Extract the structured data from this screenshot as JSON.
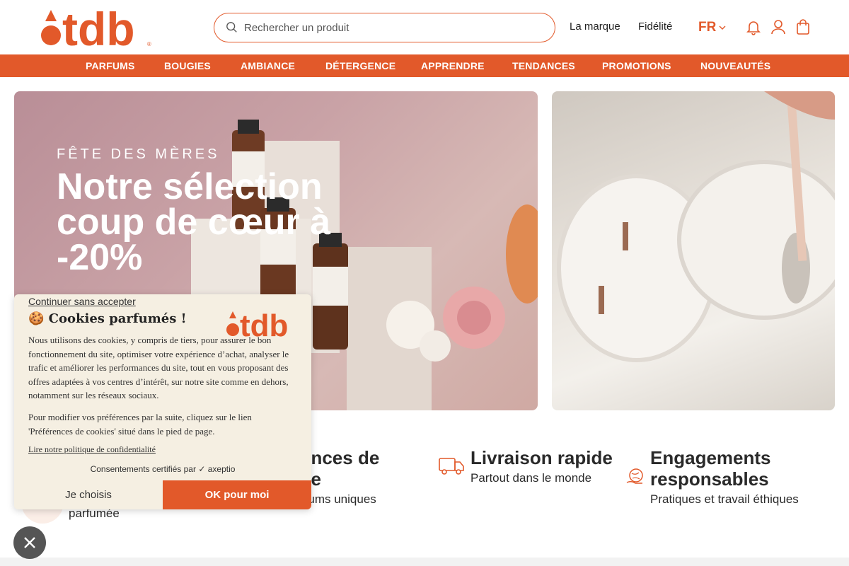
{
  "brand": {
    "name": "itdb",
    "accent": "#e2592a"
  },
  "header": {
    "search_placeholder": "Rechercher un produit",
    "links": [
      "La marque",
      "Fidélité"
    ],
    "lang": "FR",
    "icons": [
      "bell-icon",
      "user-icon",
      "bag-icon"
    ]
  },
  "nav": [
    "PARFUMS",
    "BOUGIES",
    "AMBIANCE",
    "DÉTERGENCE",
    "APPRENDRE",
    "TENDANCES",
    "PROMOTIONS",
    "NOUVEAUTÉS"
  ],
  "hero": {
    "eyebrow": "FÊTE DES MÈRES",
    "title": "Notre sélection coup de cœur à -20%"
  },
  "features": [
    {
      "title": "ances de",
      "title2": "se",
      "sub": "rfums uniques"
    },
    {
      "title": "Livraison rapide",
      "sub": "Partout dans le monde"
    },
    {
      "title": "Engagements",
      "title2": "responsables",
      "sub": "Pratiques et travail éthiques"
    }
  ],
  "peek_text": "parfumée",
  "cookie": {
    "continue": "Continuer sans accepter",
    "title": "🍪 Cookies parfumés !",
    "p1": "Nous utilisons des cookies, y compris de tiers, pour assurer le bon fonctionnement du site, optimiser votre expérience d’achat, analyser le trafic et améliorer les performances du site, tout en vous proposant des offres adaptées à vos centres d’intérêt, sur notre site comme en dehors, notamment sur les réseaux sociaux.",
    "p2": "Pour modifier vos préférences par la suite, cliquez sur le lien 'Préférences de cookies' situé dans le pied de page.",
    "policy": "Lire notre politique de confidentialité",
    "certified": "Consentements certifiés par",
    "certifier": "axeptio",
    "choose": "Je choisis",
    "ok": "OK pour moi"
  }
}
